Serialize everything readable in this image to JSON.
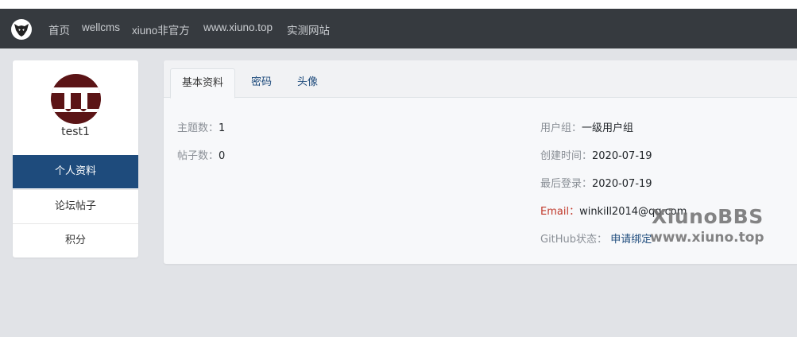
{
  "nav": {
    "links": [
      "首页",
      "wellcms",
      "xiuno非官方",
      "www.xiuno.top",
      "实测网站"
    ]
  },
  "sidebar": {
    "username": "test1",
    "menu": [
      {
        "label": "个人资料",
        "active": true
      },
      {
        "label": "论坛帖子",
        "active": false
      },
      {
        "label": "积分",
        "active": false
      }
    ]
  },
  "tabs": [
    {
      "label": "基本资料",
      "active": true
    },
    {
      "label": "密码",
      "active": false
    },
    {
      "label": "头像",
      "active": false
    }
  ],
  "profile": {
    "threads_label": "主题数：",
    "threads_value": "1",
    "posts_label": "帖子数：",
    "posts_value": "0",
    "group_label": "用户组：",
    "group_value": "一级用户组",
    "created_label": "创建时间：",
    "created_value": "2020-07-19",
    "last_login_label": "最后登录：",
    "last_login_value": "2020-07-19",
    "email_label": "Email：",
    "email_value": "winkill2014@qq.com",
    "github_label": "GitHub状态：",
    "github_value": "申请绑定"
  },
  "watermark": {
    "line1": "XiunoBBS",
    "line2": "www.xiuno.top"
  },
  "colors": {
    "navbar": "#363a3f",
    "active_menu": "#1e4b7c",
    "avatar": "#5b1416",
    "email_label": "#c0392b"
  },
  "icons": {
    "logo": "xiuno-logo-icon",
    "avatar": "default-avatar-icon"
  }
}
